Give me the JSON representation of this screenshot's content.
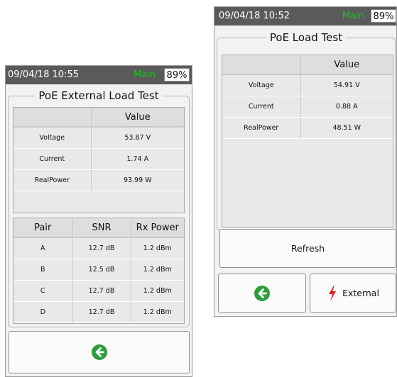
{
  "left_screen": {
    "status": {
      "time": "09/04/18 10:55",
      "mode": "Main",
      "battery": "89%"
    },
    "title": "PoE External Load Test",
    "measure_table": {
      "headers": [
        "",
        "Value"
      ],
      "rows": [
        [
          "Voltage",
          "53.87 V"
        ],
        [
          "Current",
          "1.74 A"
        ],
        [
          "RealPower",
          "93.99 W"
        ]
      ]
    },
    "pair_table": {
      "headers": [
        "Pair",
        "SNR",
        "Rx Power"
      ],
      "rows": [
        [
          "A",
          "12.7 dB",
          "1.2 dBm"
        ],
        [
          "B",
          "12.5 dB",
          "1.2 dBm"
        ],
        [
          "C",
          "12.7 dB",
          "1.2 dBm"
        ],
        [
          "D",
          "12.7 dB",
          "1.2 dBm"
        ]
      ]
    },
    "back_icon": "arrow-left-circle-icon"
  },
  "right_screen": {
    "status": {
      "time": "09/04/18 10:52",
      "mode": "Main",
      "battery": "89%"
    },
    "title": "PoE Load Test",
    "measure_table": {
      "headers": [
        "",
        "Value"
      ],
      "rows": [
        [
          "Voltage",
          "54.91 V"
        ],
        [
          "Current",
          "0.88 A"
        ],
        [
          "RealPower",
          "48.51 W"
        ]
      ]
    },
    "refresh_label": "Refresh",
    "external_label": "External",
    "back_icon": "arrow-left-circle-icon",
    "external_icon": "lightning-bolt-icon"
  },
  "colors": {
    "status_bg": "#5a5a5a",
    "mode_green": "#22c422",
    "back_green": "#2e9e3a",
    "bolt_red": "#e02020"
  }
}
